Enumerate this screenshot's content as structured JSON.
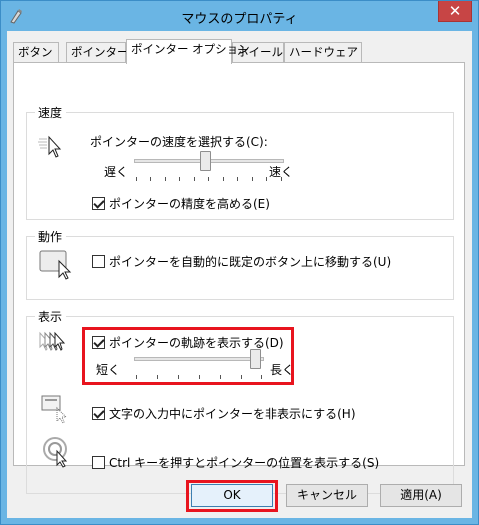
{
  "window": {
    "title": "マウスのプロパティ",
    "close_label": "✕"
  },
  "tabs": [
    {
      "label": "ボタン"
    },
    {
      "label": "ポインター"
    },
    {
      "label": "ポインター オプション"
    },
    {
      "label": "ホイール"
    },
    {
      "label": "ハードウェア"
    }
  ],
  "motion": {
    "title": "速度",
    "speed_label": "ポインターの速度を選択する(C):",
    "slow_label": "遅く",
    "fast_label": "速く",
    "speed_value": 0.5,
    "precision_label": "ポインターの精度を高める(E)",
    "precision_checked": true
  },
  "snap": {
    "title": "動作",
    "snap_label": "ポインターを自動的に既定のボタン上に移動する(U)",
    "snap_checked": false
  },
  "visibility": {
    "title": "表示",
    "trails_label": "ポインターの軌跡を表示する(D)",
    "trails_checked": true,
    "short_label": "短く",
    "long_label": "長く",
    "trails_value": 1.0,
    "hide_label": "文字の入力中にポインターを非表示にする(H)",
    "hide_checked": true,
    "ctrl_label": "Ctrl キーを押すとポインターの位置を表示する(S)",
    "ctrl_checked": false
  },
  "buttons": {
    "ok": "OK",
    "cancel": "キャンセル",
    "apply": "適用(A)"
  },
  "colors": {
    "window_frame": "#6ab5e4",
    "highlight": "#e8141e",
    "close_button": "#c74545"
  }
}
